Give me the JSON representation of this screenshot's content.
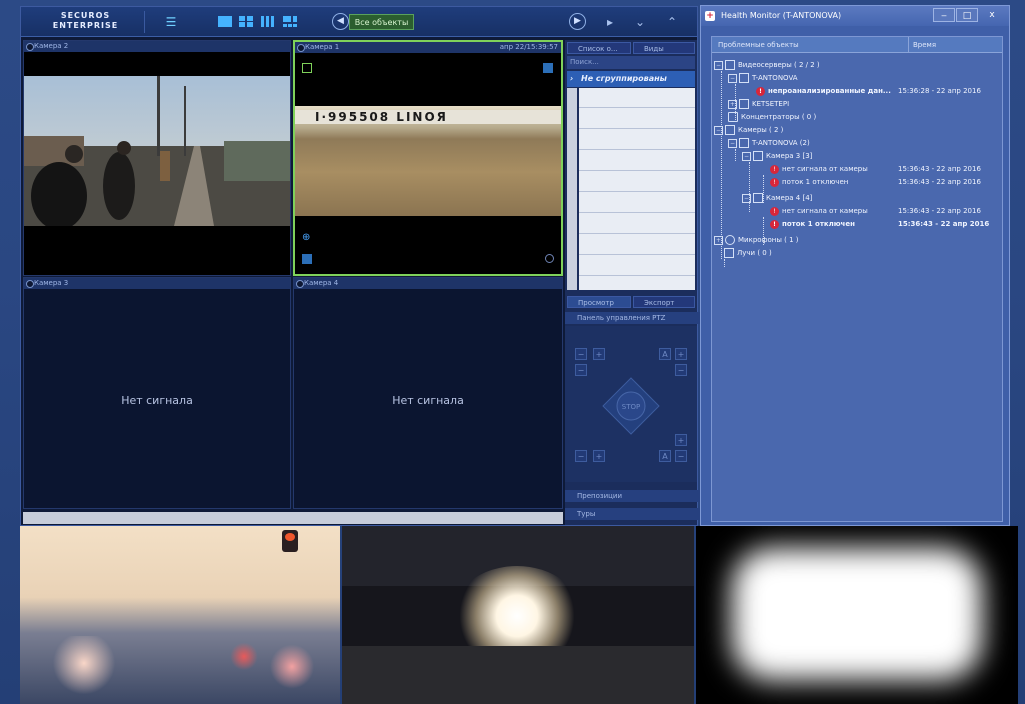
{
  "app": {
    "logo_top": "SECUROS",
    "logo_bottom": "ENTERPRISE",
    "all_objects_label": "Все объекты",
    "cameras": [
      {
        "label": "Камера 2",
        "timestamp": ""
      },
      {
        "label": "Камера 1",
        "timestamp": "апр 22/15:39:57"
      },
      {
        "label": "Камера 3",
        "timestamp": ""
      },
      {
        "label": "Камера 4",
        "timestamp": ""
      }
    ],
    "no_signal": "Нет сигнала",
    "camera_1_overlay_text": "I·995508 LINOЯ",
    "right_panel": {
      "tab_list": "Список о...",
      "tab_views": "Виды",
      "search_placeholder": "Поиск...",
      "group_label": "Не сгруппированы",
      "tab_preview": "Просмотр",
      "tab_export": "Экспорт",
      "ptz_panel": "Панель управления PTZ",
      "ptz_stop": "STOP",
      "presets": "Препозиции",
      "tours": "Туры"
    }
  },
  "health_monitor": {
    "title": "Health Monitor (T-ANTONOVA)",
    "col_objects": "Проблемные объекты",
    "col_time": "Время",
    "tree": [
      {
        "label": "Видеосерверы ( 2 / 2 )",
        "time": ""
      },
      {
        "label": "T-ANTONOVA",
        "time": ""
      },
      {
        "label": "непроанализированные дан...",
        "time": "15:36:28 - 22 апр 2016"
      },
      {
        "label": "KETSETEPI",
        "time": ""
      },
      {
        "label": "Концентраторы ( 0 )",
        "time": ""
      },
      {
        "label": "Камеры ( 2 )",
        "time": ""
      },
      {
        "label": "T-ANTONOVA (2)",
        "time": ""
      },
      {
        "label": "Камера 3 [3]",
        "time": ""
      },
      {
        "label": "нет сигнала от камеры",
        "time": "15:36:43 - 22 апр 2016"
      },
      {
        "label": "поток 1 отключен",
        "time": "15:36:43 - 22 апр 2016"
      },
      {
        "label": "Камера 4 [4]",
        "time": ""
      },
      {
        "label": "нет сигнала от камеры",
        "time": "15:36:43 - 22 апр 2016"
      },
      {
        "label": "поток 1 отключен",
        "time": "15:36:43 - 22 апр 2016"
      },
      {
        "label": "Микрофоны ( 1 )",
        "time": ""
      },
      {
        "label": "Лучи ( 0 )",
        "time": ""
      }
    ]
  },
  "colors": {
    "accent": "#45b3ff",
    "error": "#d8263a",
    "selection": "#7fd25a"
  }
}
